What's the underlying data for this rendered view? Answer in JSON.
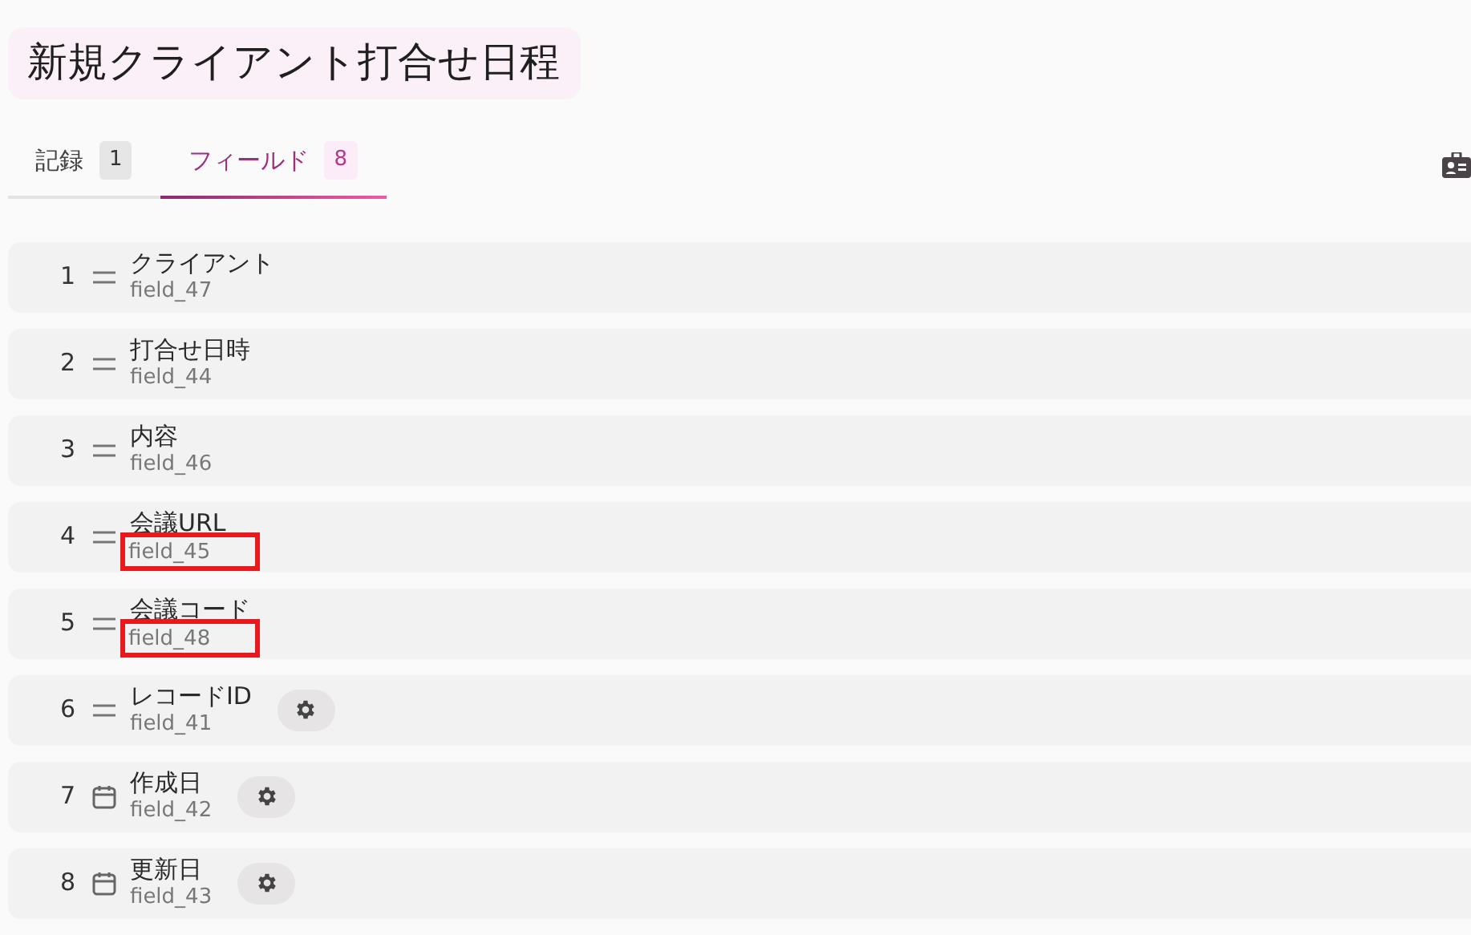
{
  "title": "新規クライアント打合せ日程",
  "tabs": [
    {
      "label": "記録",
      "count": "1",
      "selected": false
    },
    {
      "label": "フィールド",
      "count": "8",
      "selected": true
    }
  ],
  "fields": [
    {
      "number": "1",
      "kind": "text",
      "name": "クライアント",
      "id": "field_47",
      "settings": false,
      "highlighted": false
    },
    {
      "number": "2",
      "kind": "text",
      "name": "打合せ日時",
      "id": "field_44",
      "settings": false,
      "highlighted": false
    },
    {
      "number": "3",
      "kind": "text",
      "name": "内容",
      "id": "field_46",
      "settings": false,
      "highlighted": false
    },
    {
      "number": "4",
      "kind": "text",
      "name": "会議URL",
      "id": "field_45",
      "settings": false,
      "highlighted": true
    },
    {
      "number": "5",
      "kind": "text",
      "name": "会議コード",
      "id": "field_48",
      "settings": false,
      "highlighted": true
    },
    {
      "number": "6",
      "kind": "text",
      "name": "レコードID",
      "id": "field_41",
      "settings": true,
      "highlighted": false
    },
    {
      "number": "7",
      "kind": "date",
      "name": "作成日",
      "id": "field_42",
      "settings": true,
      "highlighted": false
    },
    {
      "number": "8",
      "kind": "date",
      "name": "更新日",
      "id": "field_43",
      "settings": true,
      "highlighted": false
    }
  ]
}
